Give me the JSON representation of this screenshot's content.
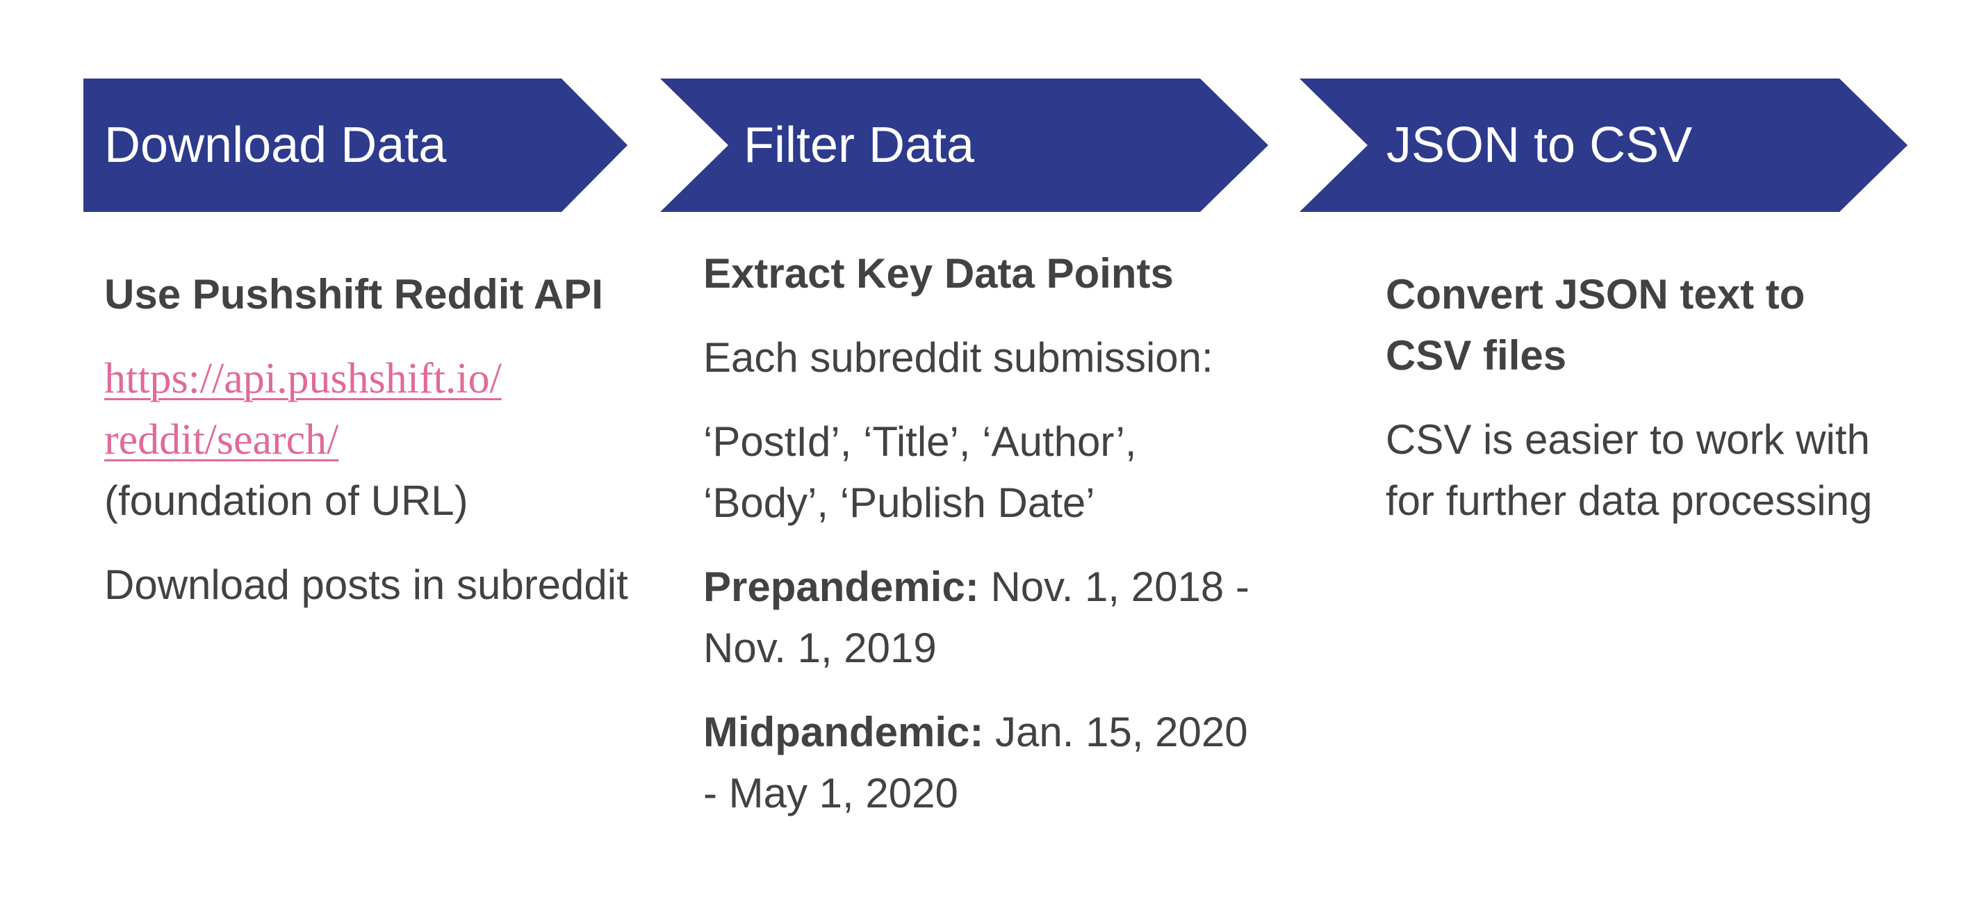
{
  "colors": {
    "chevron_fill": "#2e3a8c",
    "body_text": "#424242",
    "link": "#e06a9a",
    "background": "#ffffff"
  },
  "steps": [
    {
      "title": "Download Data",
      "heading": "Use Pushshift Reddit API",
      "link_line_1": "https://api.pushshift.io/",
      "link_line_2": "reddit/search/",
      "link_note": "(foundation of URL)",
      "description": "Download posts in subreddit"
    },
    {
      "title": "Filter Data",
      "heading": "Extract Key Data Points",
      "intro": "Each subreddit submission:",
      "fields": "‘PostId’, ‘Title’, ‘Author’, ‘Body’, ‘Publish Date’",
      "prepandemic_label": "Prepandemic:",
      "prepandemic_range": " Nov. 1, 2018 - Nov. 1, 2019",
      "midpandemic_label": "Midpandemic:",
      "midpandemic_range": " Jan. 15, 2020 - May 1, 2020"
    },
    {
      "title": "JSON to CSV",
      "heading": "Convert JSON text to CSV files",
      "description": "CSV is easier to work with for further data processing"
    }
  ]
}
